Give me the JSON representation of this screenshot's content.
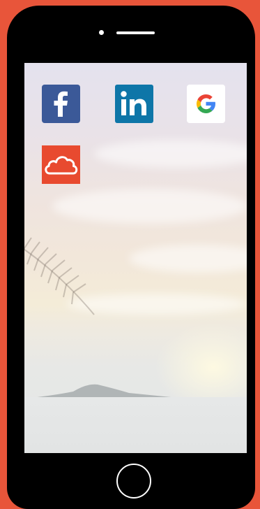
{
  "device": {
    "frame_color": "#e8553a",
    "bezel_color": "#000000"
  },
  "home_screen": {
    "apps": [
      {
        "id": "facebook",
        "icon": "facebook-icon",
        "glyph": "f",
        "color": "#3b5998"
      },
      {
        "id": "linkedin",
        "icon": "linkedin-icon",
        "glyph": "in",
        "color": "#0e76a8"
      },
      {
        "id": "google",
        "icon": "google-icon",
        "glyph": "G",
        "color": "#ffffff"
      },
      {
        "id": "cloud",
        "icon": "cloud-icon",
        "glyph": "",
        "color": "#e84a2f"
      }
    ]
  }
}
